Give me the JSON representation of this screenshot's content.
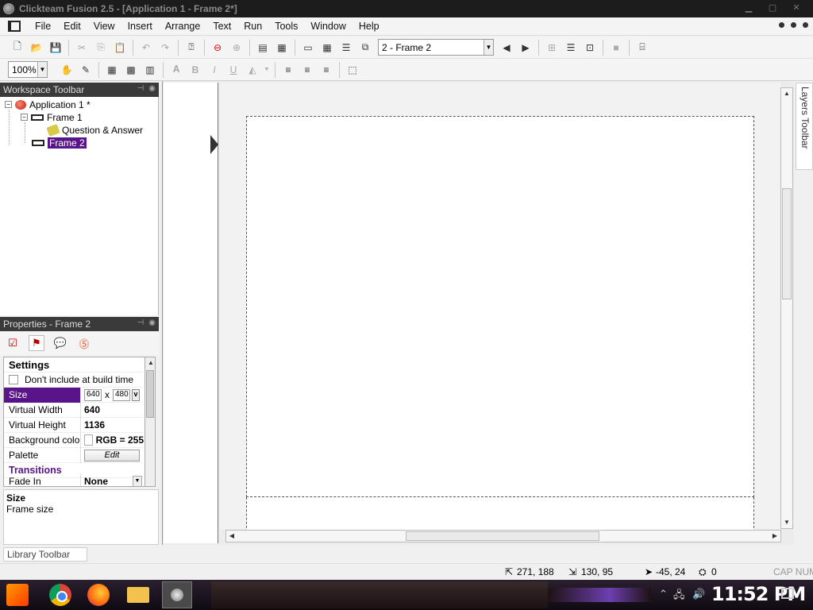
{
  "window": {
    "title": "Clickteam Fusion 2.5 - [Application 1 - Frame 2*]"
  },
  "menu": [
    "File",
    "Edit",
    "View",
    "Insert",
    "Arrange",
    "Text",
    "Run",
    "Tools",
    "Window",
    "Help"
  ],
  "toolbar": {
    "frame_select": "2 - Frame 2",
    "zoom": "100%"
  },
  "workspace": {
    "title": "Workspace Toolbar",
    "tree": {
      "application": "Application 1 *",
      "frame1": "Frame 1",
      "object": "Question & Answer",
      "frame2": "Frame 2"
    }
  },
  "properties": {
    "title": "Properties - Frame 2",
    "settings_label": "Settings",
    "dont_include": "Don't include at build time",
    "size_label": "Size",
    "size_w": "640",
    "size_x": "x",
    "size_h": "480",
    "size_btn": "v",
    "virtual_width_label": "Virtual Width",
    "virtual_width": "640",
    "virtual_height_label": "Virtual Height",
    "virtual_height": "1136",
    "bg_color_label": "Background color",
    "bg_color": "RGB = 255",
    "palette_label": "Palette",
    "palette_btn": "Edit",
    "transitions_label": "Transitions",
    "fade_in_label": "Fade In",
    "fade_in": "None",
    "help_title": "Size",
    "help_desc": "Frame size"
  },
  "layers_toolbar": "Layers Toolbar",
  "library_toolbar": "Library Toolbar",
  "status": {
    "pos": "271, 188",
    "size": "130, 95",
    "offset": "-45, 24",
    "count": "0",
    "keys": "CAP NUM"
  },
  "taskbar": {
    "clock": "11:52 PM"
  }
}
